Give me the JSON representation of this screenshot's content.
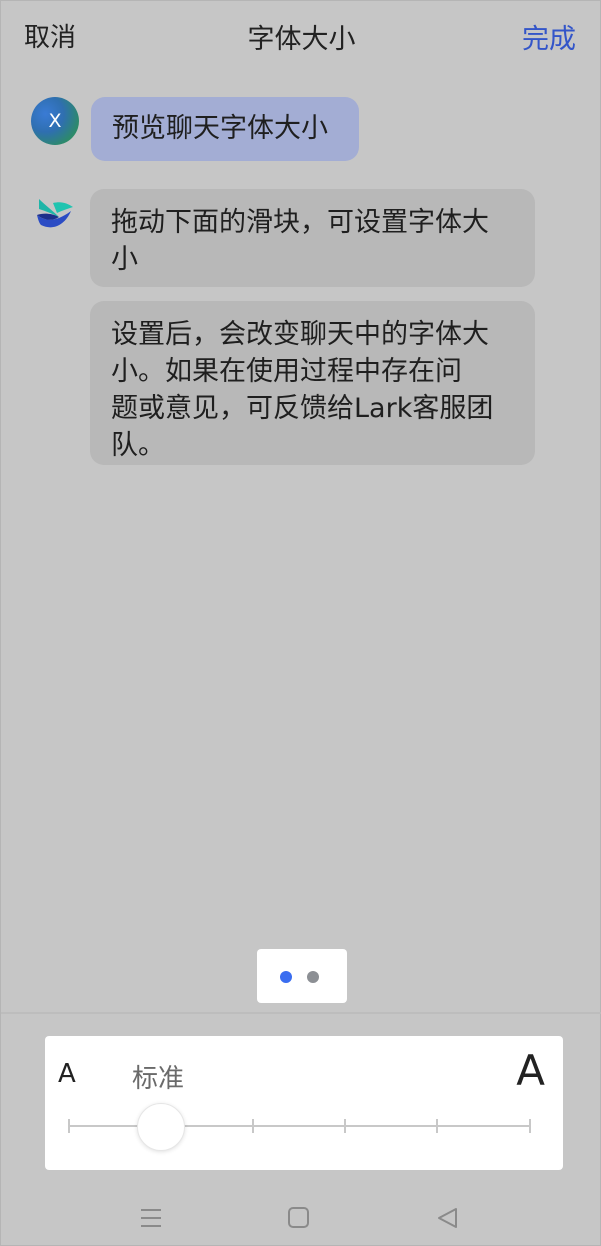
{
  "header": {
    "cancel_label": "取消",
    "title": "字体大小",
    "done_label": "完成"
  },
  "conversation": {
    "user_avatar_initial": "X",
    "user_message": "预览聊天字体大小",
    "bot_messages": [
      "拖动下面的滑块，可设置字体大\n小",
      "设置后，会改变聊天中的字体大\n小。如果在使用过程中存在问\n题或意见，可反馈给Lark客服团\n队。"
    ]
  },
  "pager": {
    "pages": 2,
    "active_index": 0
  },
  "font_size_panel": {
    "small_icon": "A",
    "large_icon": "A",
    "current_level_label": "标准",
    "levels": 6,
    "selected_level_index": 1
  },
  "system_nav": {
    "icons": [
      "menu-icon",
      "home-square-icon",
      "back-triangle-icon"
    ]
  },
  "colors": {
    "accent": "#3355c9",
    "active_dot": "#3a6df0",
    "user_bubble": "#a3add4",
    "bot_bubble": "#b8b8b8"
  }
}
